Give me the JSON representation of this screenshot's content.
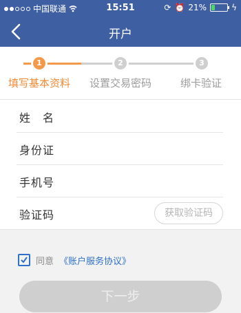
{
  "status_bar": {
    "carrier": "中国联通",
    "time": "15:51",
    "battery_percent_text": "21%",
    "battery_level": 0.21
  },
  "header": {
    "title": "开户"
  },
  "steps": [
    {
      "number": "1",
      "label": "填写基本资料",
      "active": true
    },
    {
      "number": "2",
      "label": "设置交易密码",
      "active": false
    },
    {
      "number": "3",
      "label": "绑卡验证",
      "active": false
    }
  ],
  "form": {
    "name_label": "姓　名",
    "id_label": "身份证",
    "phone_label": "手机号",
    "code_label": "验证码",
    "get_code_button": "获取验证码"
  },
  "agreement": {
    "prefix": "同意",
    "link": "《账户服务协议》",
    "checked": true
  },
  "next_button": "下一步",
  "colors": {
    "header_bg": "#3f5fa3",
    "active_step": "#f39a4a",
    "link_blue": "#2f70c9",
    "disabled_button": "#cfcfcf"
  }
}
